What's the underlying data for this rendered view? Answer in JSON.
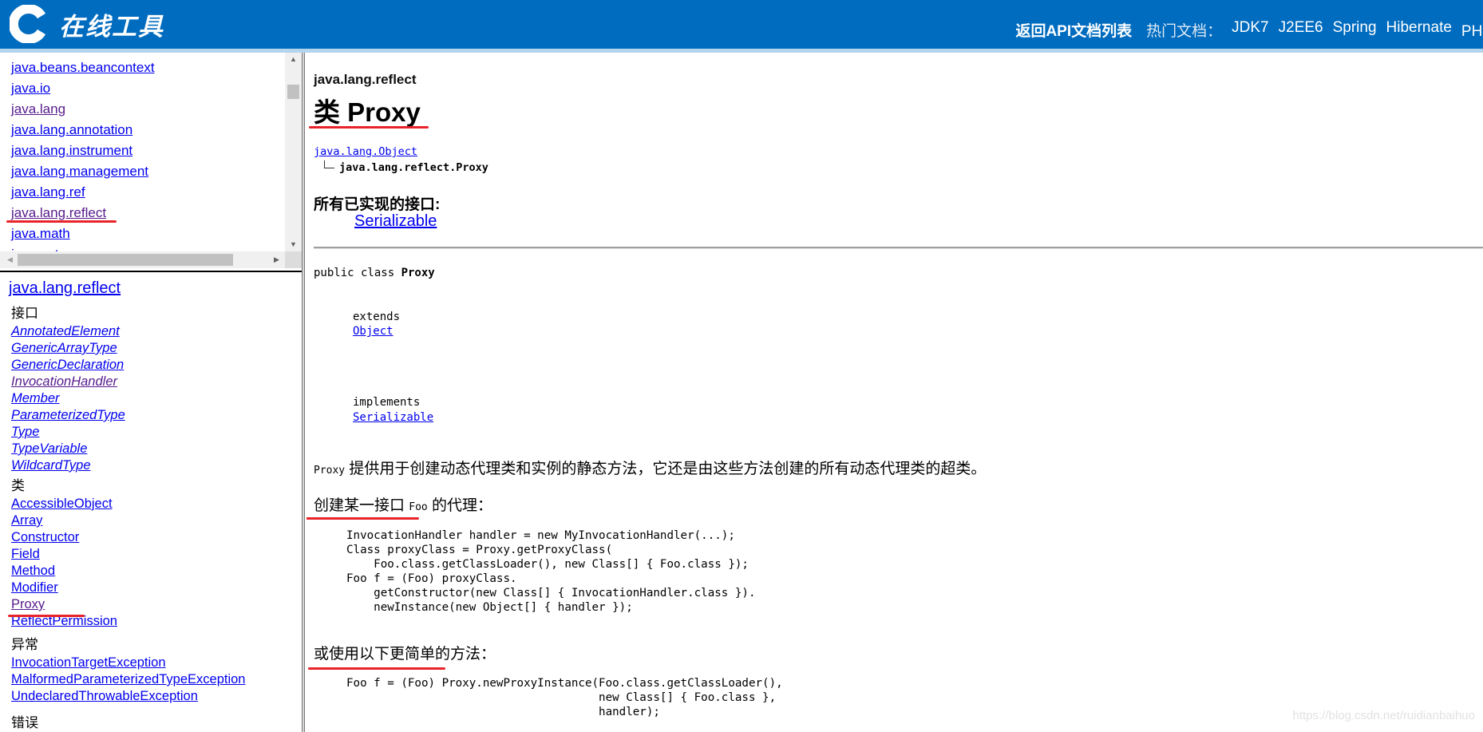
{
  "header": {
    "logo_text": "在线工具",
    "back_link": "返回API文档列表",
    "hot_label": "热门文档：",
    "hot_links": [
      "JDK7",
      "J2EE6",
      "Spring",
      "Hibernate",
      "PHP中文文档"
    ],
    "brand_color": "#006cbf"
  },
  "package_list": {
    "items": [
      {
        "label": "java.beans.beancontext",
        "visited": false
      },
      {
        "label": "java.io",
        "visited": false
      },
      {
        "label": "java.lang",
        "visited": true
      },
      {
        "label": "java.lang.annotation",
        "visited": false
      },
      {
        "label": "java.lang.instrument",
        "visited": false
      },
      {
        "label": "java.lang.management",
        "visited": false
      },
      {
        "label": "java.lang.ref",
        "visited": false
      },
      {
        "label": "java.lang.reflect",
        "visited": true
      },
      {
        "label": "java.math",
        "visited": false
      },
      {
        "label": "java.net",
        "visited": false
      }
    ]
  },
  "class_list": {
    "package_title": "java.lang.reflect",
    "interfaces_heading": "接口",
    "interfaces": [
      "AnnotatedElement",
      "GenericArrayType",
      "GenericDeclaration",
      "InvocationHandler",
      "Member",
      "ParameterizedType",
      "Type",
      "TypeVariable",
      "WildcardType"
    ],
    "classes_heading": "类",
    "classes": [
      "AccessibleObject",
      "Array",
      "Constructor",
      "Field",
      "Method",
      "Modifier",
      "Proxy",
      "ReflectPermission"
    ],
    "exceptions_heading": "异常",
    "exceptions": [
      "InvocationTargetException",
      "MalformedParameterizedTypeException",
      "UndeclaredThrowableException"
    ],
    "errors_heading": "错误"
  },
  "content": {
    "package": "java.lang.reflect",
    "title": "类 Proxy",
    "hierarchy_parent": "java.lang.Object",
    "hierarchy_self": "java.lang.reflect.Proxy",
    "implemented_heading": "所有已实现的接口:",
    "implemented_link": "Serializable",
    "decl_prefix": "public class ",
    "decl_name": "Proxy",
    "extends_label": "extends",
    "extends_link": "Object",
    "implements_label": "implements",
    "implements_link": "Serializable",
    "desc_code": "Proxy",
    "desc_text": " 提供用于创建动态代理类和实例的静态方法，它还是由这些方法创建的所有动态代理类的超类。",
    "example1_heading_pre": "创建某一接口 ",
    "example1_heading_code": "Foo",
    "example1_heading_post": " 的代理：",
    "example1_code": "InvocationHandler handler = new MyInvocationHandler(...);\nClass proxyClass = Proxy.getProxyClass(\n    Foo.class.getClassLoader(), new Class[] { Foo.class });\nFoo f = (Foo) proxyClass.\n    getConstructor(new Class[] { InvocationHandler.class }).\n    newInstance(new Object[] { handler });",
    "example2_heading": "或使用以下更简单的方法：",
    "example2_code": "Foo f = (Foo) Proxy.newProxyInstance(Foo.class.getClassLoader(),\n                                     new Class[] { Foo.class },\n                                     handler);"
  },
  "watermark": "https://blog.csdn.net/ruidianbaihuo"
}
